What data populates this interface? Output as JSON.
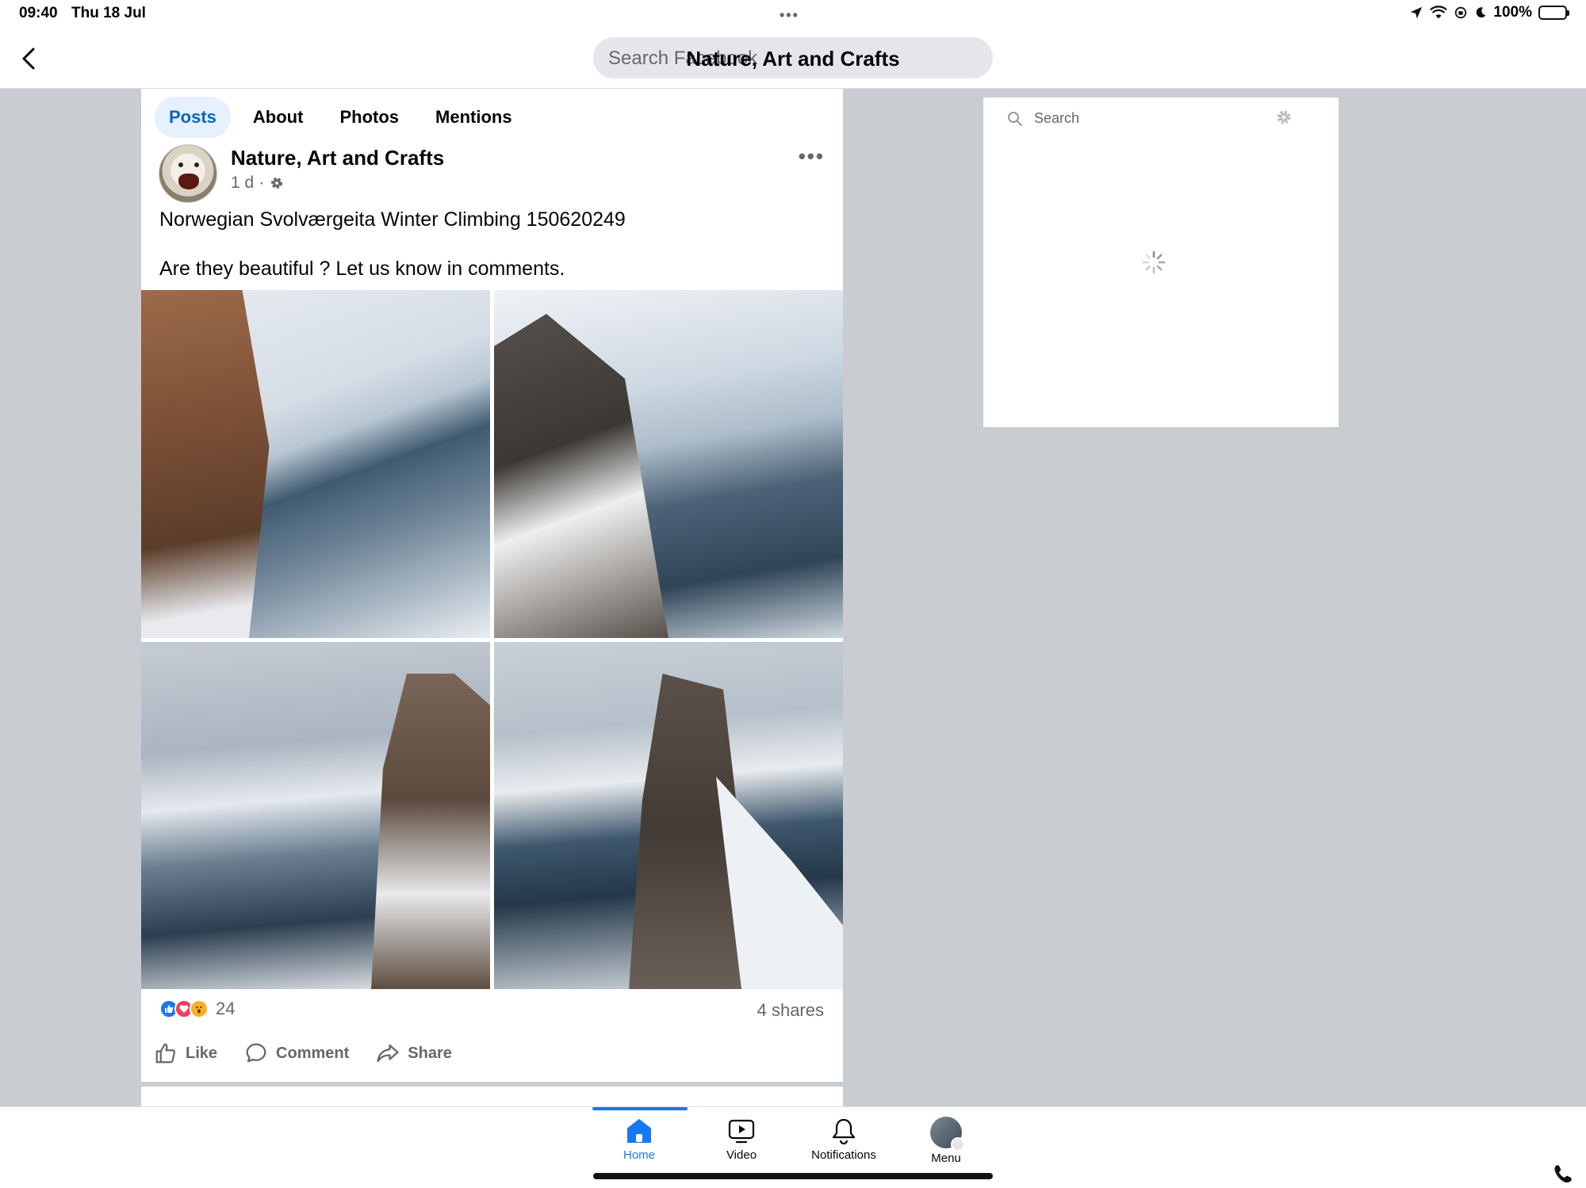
{
  "status_bar": {
    "time": "09:40",
    "date": "Thu 18 Jul",
    "battery": "100%"
  },
  "header": {
    "search_placeholder": "Search Facebook",
    "page_title": "Nature, Art and Crafts"
  },
  "tabs": [
    {
      "label": "Posts",
      "active": true
    },
    {
      "label": "About",
      "active": false
    },
    {
      "label": "Photos",
      "active": false
    },
    {
      "label": "Mentions",
      "active": false
    }
  ],
  "post": {
    "author": "Nature, Art and Crafts",
    "time": "1 d",
    "text_line1": "Norwegian Svolværgeita Winter Climbing 150620249",
    "text_line2": "Are they beautiful ? Let us know in comments.",
    "reaction_count": "24",
    "shares": "4 shares",
    "actions": {
      "like": "Like",
      "comment": "Comment",
      "share": "Share"
    }
  },
  "widget": {
    "search_placeholder": "Search"
  },
  "bottom_nav": [
    {
      "label": "Home",
      "active": true
    },
    {
      "label": "Video",
      "active": false
    },
    {
      "label": "Notifications",
      "active": false
    },
    {
      "label": "Menu",
      "active": false
    }
  ],
  "colors": {
    "accent": "#1877f2",
    "active_tab_bg": "#e7f0fd",
    "page_bg": "#c9ccd1"
  }
}
